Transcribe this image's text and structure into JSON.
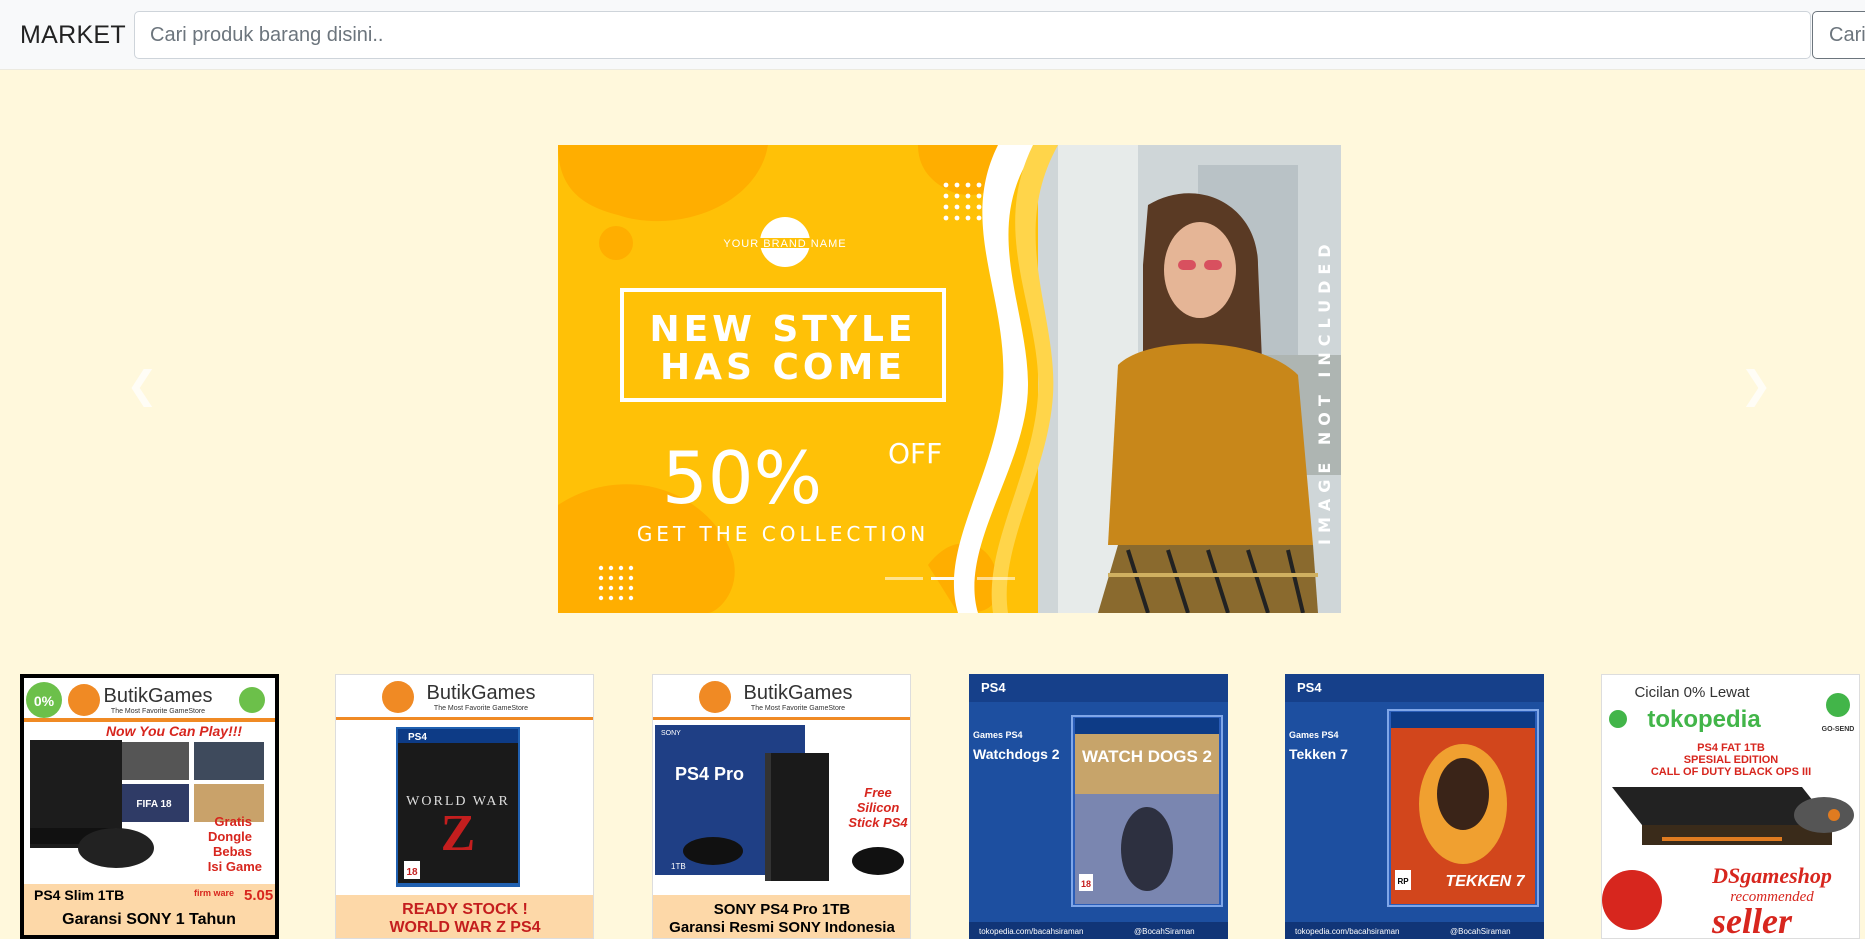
{
  "navbar": {
    "brand": "MARKET",
    "search_placeholder": "Cari produk barang disini..",
    "search_button": "Cari"
  },
  "carousel": {
    "brand_name": "YOUR BRAND NAME",
    "headline_line1": "NEW STYLE",
    "headline_line2": "HAS COME",
    "discount": "50%",
    "discount_suffix": "OFF",
    "cta": "GET THE COLLECTION",
    "side_text": "IMAGE NOT INCLUDED",
    "prev_icon": "chevron-left-icon",
    "next_icon": "chevron-right-icon",
    "slide_count": 3,
    "active_slide": 2,
    "colors": {
      "banner_yellow": "#ffc107",
      "banner_deep": "#ffae00",
      "page_bg": "#fff8dc"
    }
  },
  "products": [
    {
      "store": "ButikGames",
      "store_tag": "The Most Favorite GameStore",
      "badge": "0%",
      "headline": "Now You Can Play!!!",
      "bullets": [
        "Gratis",
        "Dongle",
        "Bebas",
        "Isi Game"
      ],
      "firmware_label": "firm ware",
      "firmware_version": "5.05",
      "title": "PS4 Slim 1TB",
      "subtitle": "Garansi SONY 1 Tahun",
      "game_tag": "FIFA 18"
    },
    {
      "store": "ButikGames",
      "store_tag": "The Most Favorite GameStore",
      "platform": "PS4",
      "game_title": "WORLD WAR",
      "game_letter": "Z",
      "rating": "18",
      "title": "READY STOCK !",
      "subtitle": "WORLD WAR Z PS4"
    },
    {
      "store": "ButikGames",
      "store_tag": "The Most Favorite GameStore",
      "box_text": "PS4 Pro",
      "box_brand": "SONY",
      "capacity": "1TB",
      "promo": [
        "Free",
        "Silicon",
        "Stick PS4"
      ],
      "title": "SONY PS4 Pro 1TB",
      "subtitle": "Garansi Resmi SONY Indonesia"
    },
    {
      "platform": "PS4",
      "label_top": "Games PS4",
      "label_name": "Watchdogs 2",
      "game_title": "WATCH DOGS 2",
      "rating": "18",
      "footer_left": "tokopedia.com/bacahsiraman",
      "footer_right": "@BocahSiraman"
    },
    {
      "platform": "PS4",
      "label_top": "Games PS4",
      "label_name": "Tekken 7",
      "game_title": "TEKKEN 7",
      "rating": "RP",
      "footer_left": "tokopedia.com/bacahsiraman",
      "footer_right": "@BocahSiraman"
    },
    {
      "top_text": "Cicilan 0% Lewat",
      "marketplace": "tokopedia",
      "courier": "GO-SEND",
      "edition_line1": "PS4 FAT 1TB",
      "edition_line2": "SPESIAL EDITION",
      "edition_line3": "CALL OF DUTY BLACK OPS III",
      "shop": "DSgameshop",
      "shop_tag": "recommended",
      "seller": "seller"
    }
  ]
}
